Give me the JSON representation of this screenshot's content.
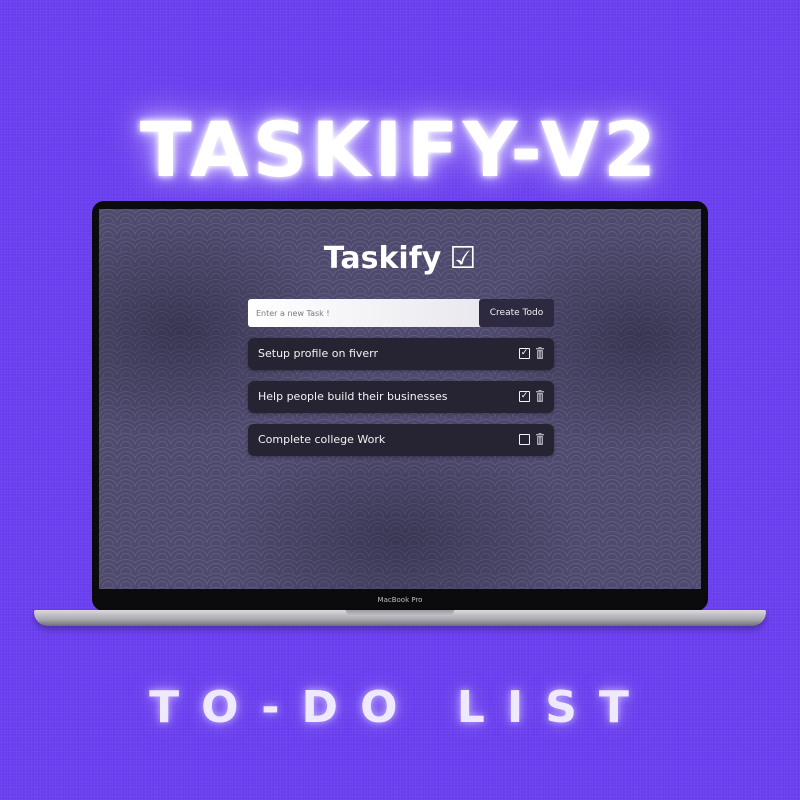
{
  "poster": {
    "headline": "TASKIFY-V2",
    "subheadline": "TO-DO LIST",
    "background_color": "#6a3ff0"
  },
  "device": {
    "model_label": "MacBook Pro"
  },
  "app": {
    "title": "Taskify",
    "title_icon": "☑",
    "new_task_input": {
      "value": "",
      "placeholder": "Enter a new Task !"
    },
    "create_button_label": "Create Todo",
    "todos": [
      {
        "text": "Setup profile on fiverr",
        "done": true,
        "done_mark": "✓",
        "delete_icon": "trash-icon"
      },
      {
        "text": "Help people build their businesses",
        "done": true,
        "done_mark": "✓",
        "delete_icon": "trash-icon"
      },
      {
        "text": "Complete college Work",
        "done": false,
        "done_mark": "",
        "delete_icon": "trash-icon"
      }
    ]
  }
}
